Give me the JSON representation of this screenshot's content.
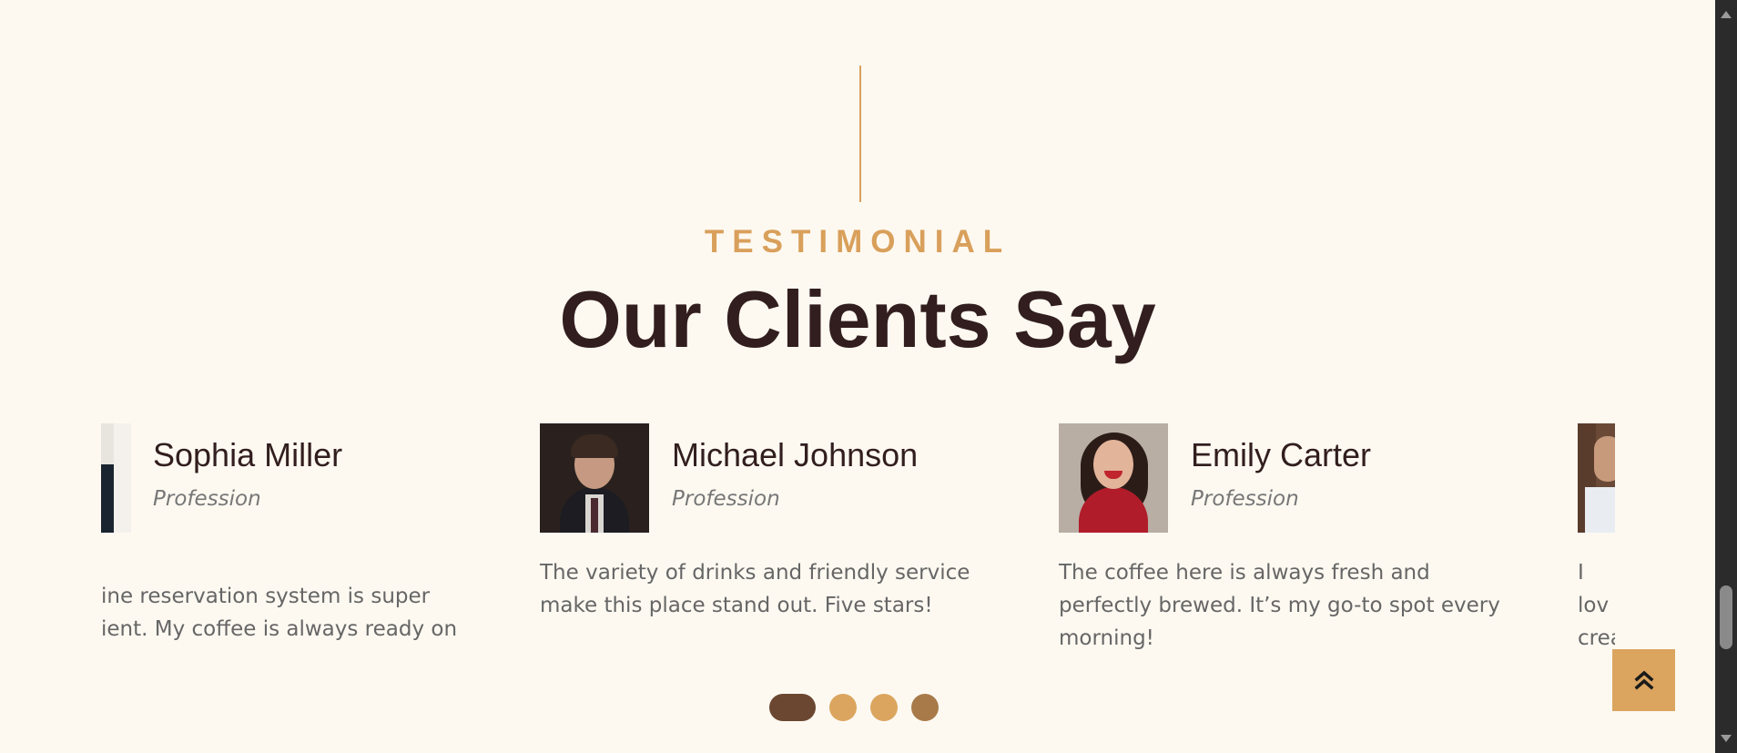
{
  "section": {
    "eyebrow": "TESTIMONIAL",
    "title": "Our Clients Say"
  },
  "testimonials": [
    {
      "name": "Sophia Miller",
      "profession": "Profession",
      "quote": "ine reservation system is super ient. My coffee is always ready on",
      "avatar_icon": "woman-portrait-photo"
    },
    {
      "name": "Michael Johnson",
      "profession": "Profession",
      "quote": "The variety of drinks and friendly service make this place stand out. Five stars!",
      "avatar_icon": "man-portrait-photo"
    },
    {
      "name": "Emily Carter",
      "profession": "Profession",
      "quote": "The coffee here is always fresh and perfectly brewed. It’s my go-to spot every morning!",
      "avatar_icon": "woman-portrait-photo"
    },
    {
      "name": "",
      "profession": "",
      "quote": "I lov crea reco",
      "avatar_icon": "man-portrait-photo"
    }
  ],
  "pagination": {
    "active_index": 0,
    "count": 4
  },
  "back_to_top": {
    "icon": "double-chevron-up-icon"
  },
  "colors": {
    "background": "#fdf9f1",
    "accent": "#d9a05b",
    "heading": "#321e1e",
    "dot_active": "#6b4630",
    "dot": "#dba55f",
    "dot_dark": "#a87a4a",
    "back_to_top_bg": "#dba55f"
  }
}
